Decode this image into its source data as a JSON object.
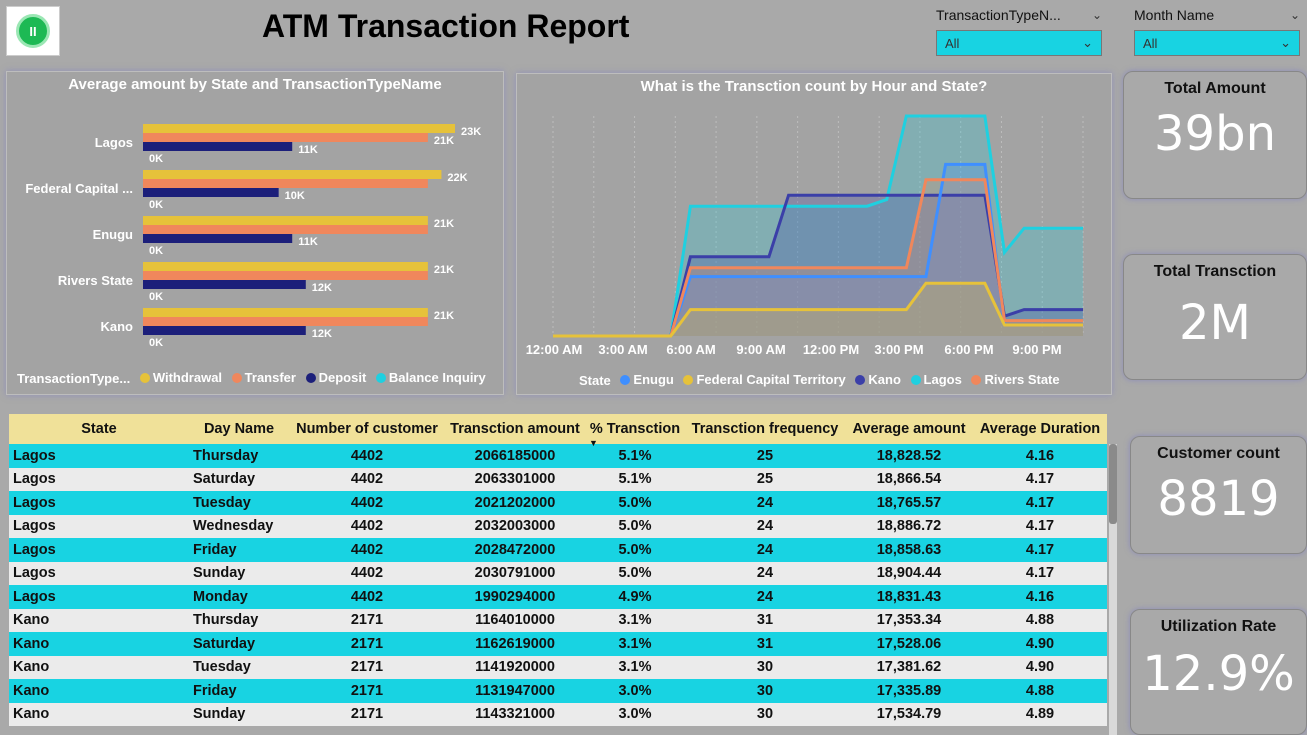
{
  "report_title": "ATM Transaction Report",
  "logo_text": "II",
  "slicers": [
    {
      "label": "TransactionTypeN...",
      "value": "All"
    },
    {
      "label": "Month Name",
      "value": "All"
    }
  ],
  "bar_chart": {
    "title": "Average amount by State and TransactionTypeName",
    "legend_title": "TransactionType...",
    "legend": [
      {
        "name": "Withdrawal",
        "color": "#e6c23a"
      },
      {
        "name": "Transfer",
        "color": "#f0875c"
      },
      {
        "name": "Deposit",
        "color": "#1c1f7a"
      },
      {
        "name": "Balance Inquiry",
        "color": "#1fd0e0"
      }
    ]
  },
  "line_chart": {
    "title": "What is the Transction count by Hour and State?",
    "x_ticks": [
      "12:00 AM",
      "3:00 AM",
      "6:00 AM",
      "9:00 AM",
      "12:00 PM",
      "3:00 PM",
      "6:00 PM",
      "9:00 PM"
    ],
    "legend_title": "State",
    "legend": [
      {
        "name": "Enugu",
        "color": "#3f8fff"
      },
      {
        "name": "Federal Capital Territory",
        "color": "#e6c23a"
      },
      {
        "name": "Kano",
        "color": "#3b3fa8"
      },
      {
        "name": "Lagos",
        "color": "#1fd0e0"
      },
      {
        "name": "Rivers State",
        "color": "#f0875c"
      }
    ]
  },
  "chart_data": [
    {
      "type": "bar",
      "title": "Average amount by State and TransactionTypeName",
      "categories": [
        "Lagos",
        "Federal Capital ...",
        "Enugu",
        "Rivers State",
        "Kano"
      ],
      "series": [
        {
          "name": "Withdrawal",
          "values": [
            23000,
            22000,
            21000,
            21000,
            21000
          ],
          "labels": [
            "23K",
            "22K",
            "21K",
            "21K",
            "21K"
          ]
        },
        {
          "name": "Transfer",
          "values": [
            21000,
            21000,
            21000,
            21000,
            21000
          ],
          "labels": [
            "21K",
            "",
            "",
            "",
            ""
          ]
        },
        {
          "name": "Deposit",
          "values": [
            11000,
            10000,
            11000,
            12000,
            12000
          ],
          "labels": [
            "11K",
            "10K",
            "11K",
            "12K",
            "12K"
          ]
        },
        {
          "name": "Balance Inquiry",
          "values": [
            0,
            0,
            0,
            0,
            0
          ],
          "labels": [
            "0K",
            "0K",
            "0K",
            "0K",
            "0K"
          ]
        }
      ],
      "xlim": [
        0,
        23000
      ]
    },
    {
      "type": "area",
      "title": "What is the Transction count by Hour and State?",
      "x": [
        0,
        1,
        2,
        3,
        4,
        5,
        6,
        7,
        8,
        9,
        10,
        11,
        12,
        13,
        14,
        15,
        16,
        17,
        18,
        19,
        20,
        21,
        22,
        23
      ],
      "ylim": [
        0,
        100
      ],
      "series": [
        {
          "name": "Lagos",
          "values": [
            0,
            0,
            0,
            0,
            0,
            0,
            0,
            59,
            59,
            59,
            59,
            59,
            59,
            59,
            59,
            59,
            59,
            62,
            100,
            100,
            100,
            100,
            100,
            38,
            49,
            49,
            49,
            49
          ]
        },
        {
          "name": "Kano",
          "values": [
            0,
            0,
            0,
            0,
            0,
            0,
            0,
            36,
            36,
            36,
            36,
            36,
            64,
            64,
            64,
            64,
            64,
            64,
            64,
            64,
            64,
            64,
            64,
            9,
            12,
            12,
            12,
            12
          ]
        },
        {
          "name": "Enugu",
          "values": [
            0,
            0,
            0,
            0,
            0,
            0,
            0,
            27,
            27,
            27,
            27,
            27,
            27,
            27,
            27,
            27,
            27,
            27,
            27,
            27,
            78,
            78,
            78,
            5,
            5,
            5,
            5,
            5
          ]
        },
        {
          "name": "Rivers State",
          "values": [
            0,
            0,
            0,
            0,
            0,
            0,
            0,
            31,
            31,
            31,
            31,
            31,
            31,
            31,
            31,
            31,
            31,
            31,
            31,
            71,
            71,
            71,
            71,
            7,
            7,
            7,
            7,
            7
          ]
        },
        {
          "name": "Federal Capital Territory",
          "values": [
            0,
            0,
            0,
            0,
            0,
            0,
            0,
            12,
            12,
            12,
            12,
            12,
            12,
            12,
            12,
            12,
            12,
            12,
            12,
            24,
            24,
            24,
            24,
            5,
            5,
            5,
            5,
            5
          ]
        }
      ]
    }
  ],
  "table": {
    "headers": [
      "State",
      "Day Name",
      "Number of customer",
      "Transction amount",
      "% Transction",
      "Transction frequency",
      "Average amount",
      "Average Duration"
    ],
    "rows": [
      [
        "Lagos",
        "Thursday",
        "4402",
        "2066185000",
        "5.1%",
        "25",
        "18,828.52",
        "4.16"
      ],
      [
        "Lagos",
        "Saturday",
        "4402",
        "2063301000",
        "5.1%",
        "25",
        "18,866.54",
        "4.17"
      ],
      [
        "Lagos",
        "Tuesday",
        "4402",
        "2021202000",
        "5.0%",
        "24",
        "18,765.57",
        "4.17"
      ],
      [
        "Lagos",
        "Wednesday",
        "4402",
        "2032003000",
        "5.0%",
        "24",
        "18,886.72",
        "4.17"
      ],
      [
        "Lagos",
        "Friday",
        "4402",
        "2028472000",
        "5.0%",
        "24",
        "18,858.63",
        "4.17"
      ],
      [
        "Lagos",
        "Sunday",
        "4402",
        "2030791000",
        "5.0%",
        "24",
        "18,904.44",
        "4.17"
      ],
      [
        "Lagos",
        "Monday",
        "4402",
        "1990294000",
        "4.9%",
        "24",
        "18,831.43",
        "4.16"
      ],
      [
        "Kano",
        "Thursday",
        "2171",
        "1164010000",
        "3.1%",
        "31",
        "17,353.34",
        "4.88"
      ],
      [
        "Kano",
        "Saturday",
        "2171",
        "1162619000",
        "3.1%",
        "31",
        "17,528.06",
        "4.90"
      ],
      [
        "Kano",
        "Tuesday",
        "2171",
        "1141920000",
        "3.1%",
        "30",
        "17,381.62",
        "4.90"
      ],
      [
        "Kano",
        "Friday",
        "2171",
        "1131947000",
        "3.0%",
        "30",
        "17,335.89",
        "4.88"
      ],
      [
        "Kano",
        "Sunday",
        "2171",
        "1143321000",
        "3.0%",
        "30",
        "17,534.79",
        "4.89"
      ]
    ]
  },
  "cards": [
    {
      "title": "Total Amount",
      "value": "39bn"
    },
    {
      "title": "Total Transction",
      "value": "2M"
    },
    {
      "title": "Customer count",
      "value": "8819"
    },
    {
      "title": "Utilization Rate",
      "value": "12.9%"
    }
  ]
}
